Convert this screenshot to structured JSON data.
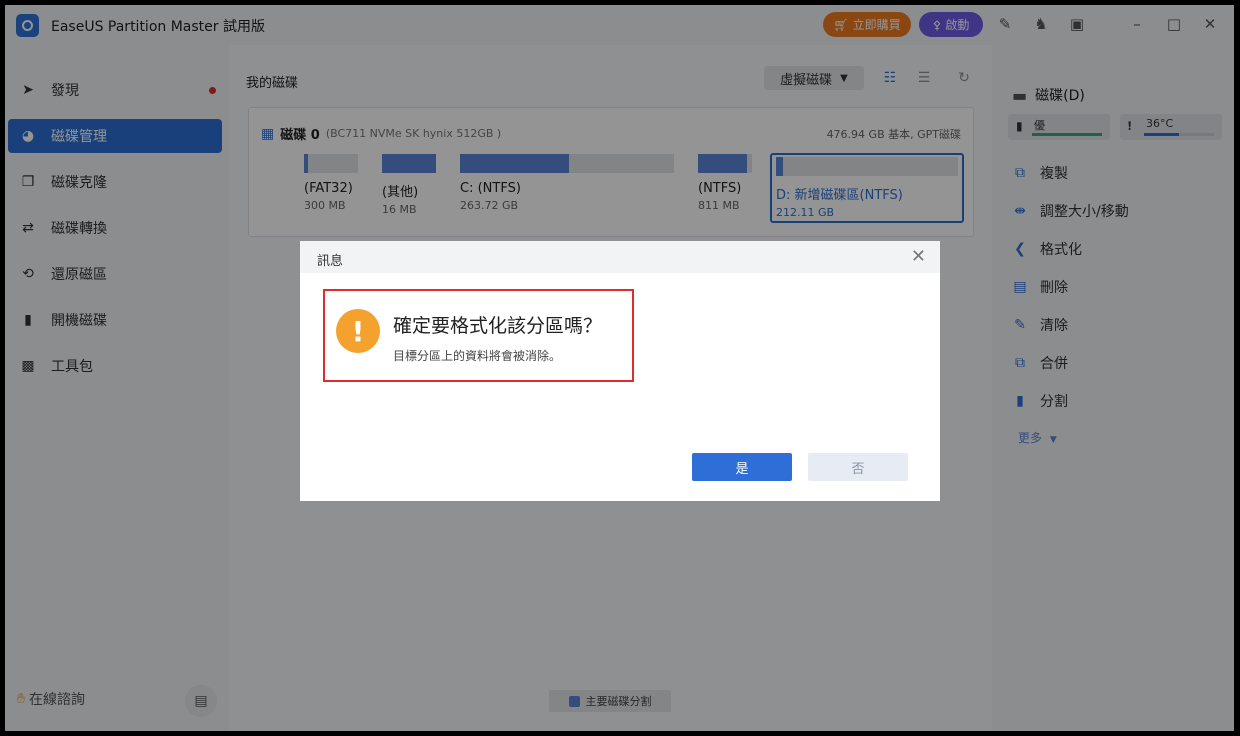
{
  "app": {
    "title": "EaseUS Partition Master 試用版",
    "buy_label": "立即購買",
    "activate_label": "啟動"
  },
  "sidebar": {
    "items": [
      {
        "label": "發現",
        "icon": "compass-icon"
      },
      {
        "label": "磁碟管理",
        "icon": "pie-chart-icon"
      },
      {
        "label": "磁碟克隆",
        "icon": "clone-icon"
      },
      {
        "label": "磁碟轉換",
        "icon": "convert-icon"
      },
      {
        "label": "還原磁區",
        "icon": "recover-icon"
      },
      {
        "label": "開機磁碟",
        "icon": "usb-icon"
      },
      {
        "label": "工具包",
        "icon": "toolbox-icon"
      }
    ],
    "consult_label": "在線諮詢"
  },
  "main": {
    "title": "我的磁碟",
    "virtual_disk_label": "虛擬磁碟",
    "disk": {
      "name": "磁碟 0",
      "model": "(BC711 NVMe SK hynix 512GB )",
      "info": "476.94 GB 基本, GPT磁碟",
      "partitions": [
        {
          "name": "(FAT32)",
          "size": "300 MB",
          "used": 0.08
        },
        {
          "name": "(其他)",
          "size": "16 MB",
          "used": 1.0
        },
        {
          "name": "C: (NTFS)",
          "size": "263.72 GB",
          "used": 0.51
        },
        {
          "name": "(NTFS)",
          "size": "811 MB",
          "used": 0.9
        },
        {
          "name": "D: 新增磁碟區(NTFS)",
          "size": "212.11 GB",
          "used": 0.01
        }
      ]
    },
    "legend_label": "主要磁碟分割"
  },
  "right": {
    "disk_label": "磁碟(D)",
    "health_label": "優",
    "temp_label": "36°C",
    "ops": [
      "複製",
      "調整大小/移動",
      "格式化",
      "刪除",
      "清除",
      "合併",
      "分割"
    ],
    "more_label": "更多"
  },
  "dialog": {
    "title": "訊息",
    "question": "確定要格式化該分區嗎？",
    "detail": "目標分區上的資料將會被消除。",
    "yes_label": "是",
    "no_label": "否"
  },
  "colors": {
    "accent": "#2d6fd6",
    "buy": "#f07a20",
    "activate": "#6d5ae6",
    "warning": "#f4a12d",
    "highlight": "#e02c2c"
  }
}
